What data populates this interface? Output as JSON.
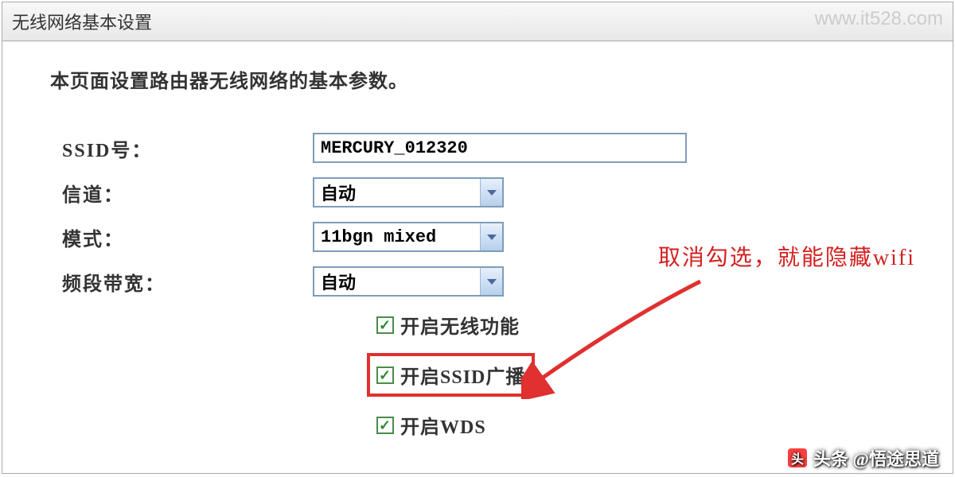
{
  "header": {
    "title": "无线网络基本设置"
  },
  "description": "本页面设置路由器无线网络的基本参数。",
  "form": {
    "ssid": {
      "label": "SSID号：",
      "value": "MERCURY_012320"
    },
    "channel": {
      "label": "信道：",
      "value": "自动"
    },
    "mode": {
      "label": "模式：",
      "value": "11bgn mixed"
    },
    "bandwidth": {
      "label": "频段带宽：",
      "value": "自动"
    }
  },
  "checkboxes": {
    "wireless": {
      "label": "开启无线功能",
      "checked": true
    },
    "ssid_broadcast": {
      "label": "开启SSID广播",
      "checked": true
    },
    "wds": {
      "label": "开启WDS",
      "checked": true
    }
  },
  "annotation": {
    "text": "取消勾选，就能隐藏wifi"
  },
  "watermark": {
    "url": "www.it528.com",
    "bottom": "头条 @悟途思道"
  }
}
